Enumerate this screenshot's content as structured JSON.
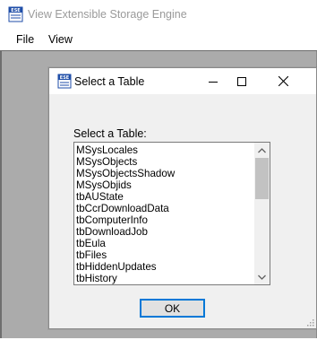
{
  "app": {
    "title": "View Extensible Storage Engine",
    "icon": "ese-database-icon",
    "icon_label": "ESE",
    "menu": [
      "File",
      "View"
    ]
  },
  "dialog": {
    "title": "Select a Table",
    "icon": "ese-database-icon",
    "icon_label": "ESE",
    "label": "Select a Table:",
    "items": [
      "MSysLocales",
      "MSysObjects",
      "MSysObjectsShadow",
      "MSysObjids",
      "tbAUState",
      "tbCcrDownloadData",
      "tbComputerInfo",
      "tbDownloadJob",
      "tbEula",
      "tbFiles",
      "tbHiddenUpdates",
      "tbHistory"
    ],
    "ok_label": "OK",
    "scroll_position": 0
  },
  "colors": {
    "accent": "#0078d7",
    "workspace": "#ababab",
    "dialog_bg": "#f0f0f0",
    "icon_blue": "#1f4ea8"
  }
}
